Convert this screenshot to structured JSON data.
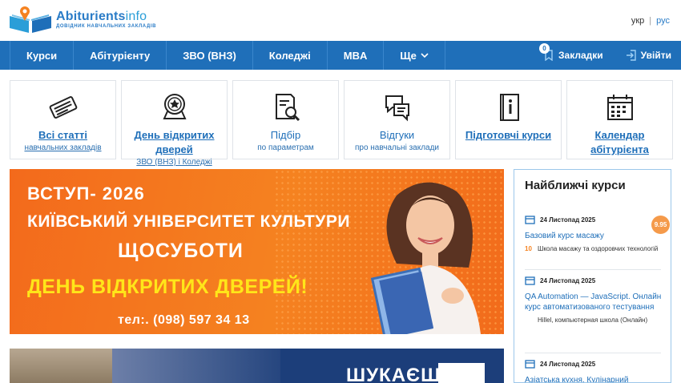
{
  "header": {
    "logo_main": "Abiturients",
    "logo_tail": "info",
    "logo_sub": "ДОВІДНИК НАВЧАЛЬНИХ ЗАКЛАДІВ",
    "lang": [
      "укр",
      "рус"
    ],
    "lang_sep": "|"
  },
  "nav": {
    "items": [
      "Курси",
      "Абітурієнту",
      "ЗВО (ВНЗ)",
      "Коледжі",
      "MBA",
      "Ще"
    ],
    "bookmarks_label": "Закладки",
    "bookmarks_count": "0",
    "login_label": "Увійти"
  },
  "tiles": [
    {
      "title": "Всі статті",
      "sub": "навчальних закладів",
      "icon": "newspapers-icon"
    },
    {
      "title": "День відкритих дверей",
      "sub": "ЗВО (ВНЗ) і Коледжі",
      "icon": "award-badge-icon"
    },
    {
      "title": "Підбір",
      "sub": "по параметрам",
      "icon": "document-search-icon"
    },
    {
      "title": "Відгуки",
      "sub": "про навчальні заклади",
      "icon": "chat-bubbles-icon"
    },
    {
      "title": "Підготовчі курси",
      "sub": "",
      "icon": "info-book-icon"
    },
    {
      "title": "Календар абітурієнта",
      "sub": "",
      "icon": "calendar-icon"
    }
  ],
  "banner": {
    "line1": "ВСТУП- 2026",
    "line2": "КИЇВСЬКИЙ УНІВЕРСИТЕТ  КУЛЬТУРИ",
    "line3": "ЩОСУБОТИ",
    "line4": "ДЕНЬ ВІДКРИТИХ ДВЕРЕЙ!",
    "line5": "тел:. (098) 597 34 13",
    "accent_color": "#f58220",
    "highlight_color": "#ffe619"
  },
  "banner2": {
    "text": "ШУКАЄШ"
  },
  "sidebar": {
    "title": "Найближчі курси",
    "courses": [
      {
        "date": "24 Листопад 2025",
        "title": "Базовий курс масажу",
        "org_num": "10",
        "org": "Школа масажу та оздоровчих технологій",
        "rating": "9.95"
      },
      {
        "date": "24 Листопад 2025",
        "title": "QA Automation — JavaScript. Онлайн курс автоматизованого тестування",
        "org_num": "",
        "org": "Hillel, компьютерная школа (Онлайн)",
        "rating": ""
      },
      {
        "date": "24 Листопад 2025",
        "title": "Азіатська кухня. Кулінарний",
        "org_num": "",
        "org": "",
        "rating": ""
      }
    ]
  },
  "colors": {
    "brand_blue": "#1f6fb9",
    "link_blue": "#2a7cc7"
  }
}
